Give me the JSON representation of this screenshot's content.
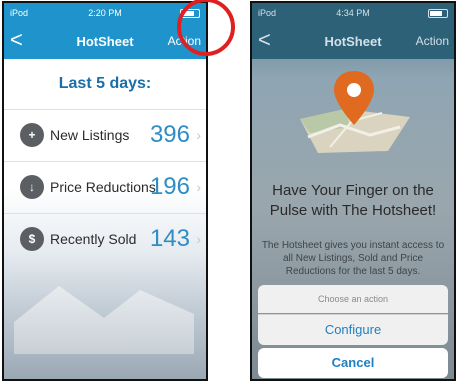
{
  "left": {
    "status": {
      "carrier": "iPod",
      "time": "2:20 PM"
    },
    "nav": {
      "back": "<",
      "title": "HotSheet",
      "action": "Action"
    },
    "period": "Last 5 days:",
    "rows": [
      {
        "icon": "home-plus-icon",
        "label": "New Listings",
        "count": "396"
      },
      {
        "icon": "down-arrow-icon",
        "label": "Price Reductions",
        "count": "196"
      },
      {
        "icon": "home-dollar-icon",
        "label": "Recently Sold",
        "count": "143"
      }
    ]
  },
  "right": {
    "status": {
      "carrier": "iPod",
      "time": "4:34 PM"
    },
    "nav": {
      "back": "<",
      "title": "HotSheet",
      "action": "Action"
    },
    "promo": {
      "title": "Have Your Finger on the Pulse with The Hotsheet!",
      "body": "The Hotsheet gives you instant access to all New Listings, Sold and Price Reductions for the last 5 days."
    },
    "sheet": {
      "title": "Choose an action",
      "configure": "Configure",
      "cancel": "Cancel"
    }
  },
  "colors": {
    "nav_blue": "#1f93cc",
    "count_blue": "#2f8cc4",
    "callout_red": "#e02020",
    "pin_orange": "#e06a1f"
  }
}
